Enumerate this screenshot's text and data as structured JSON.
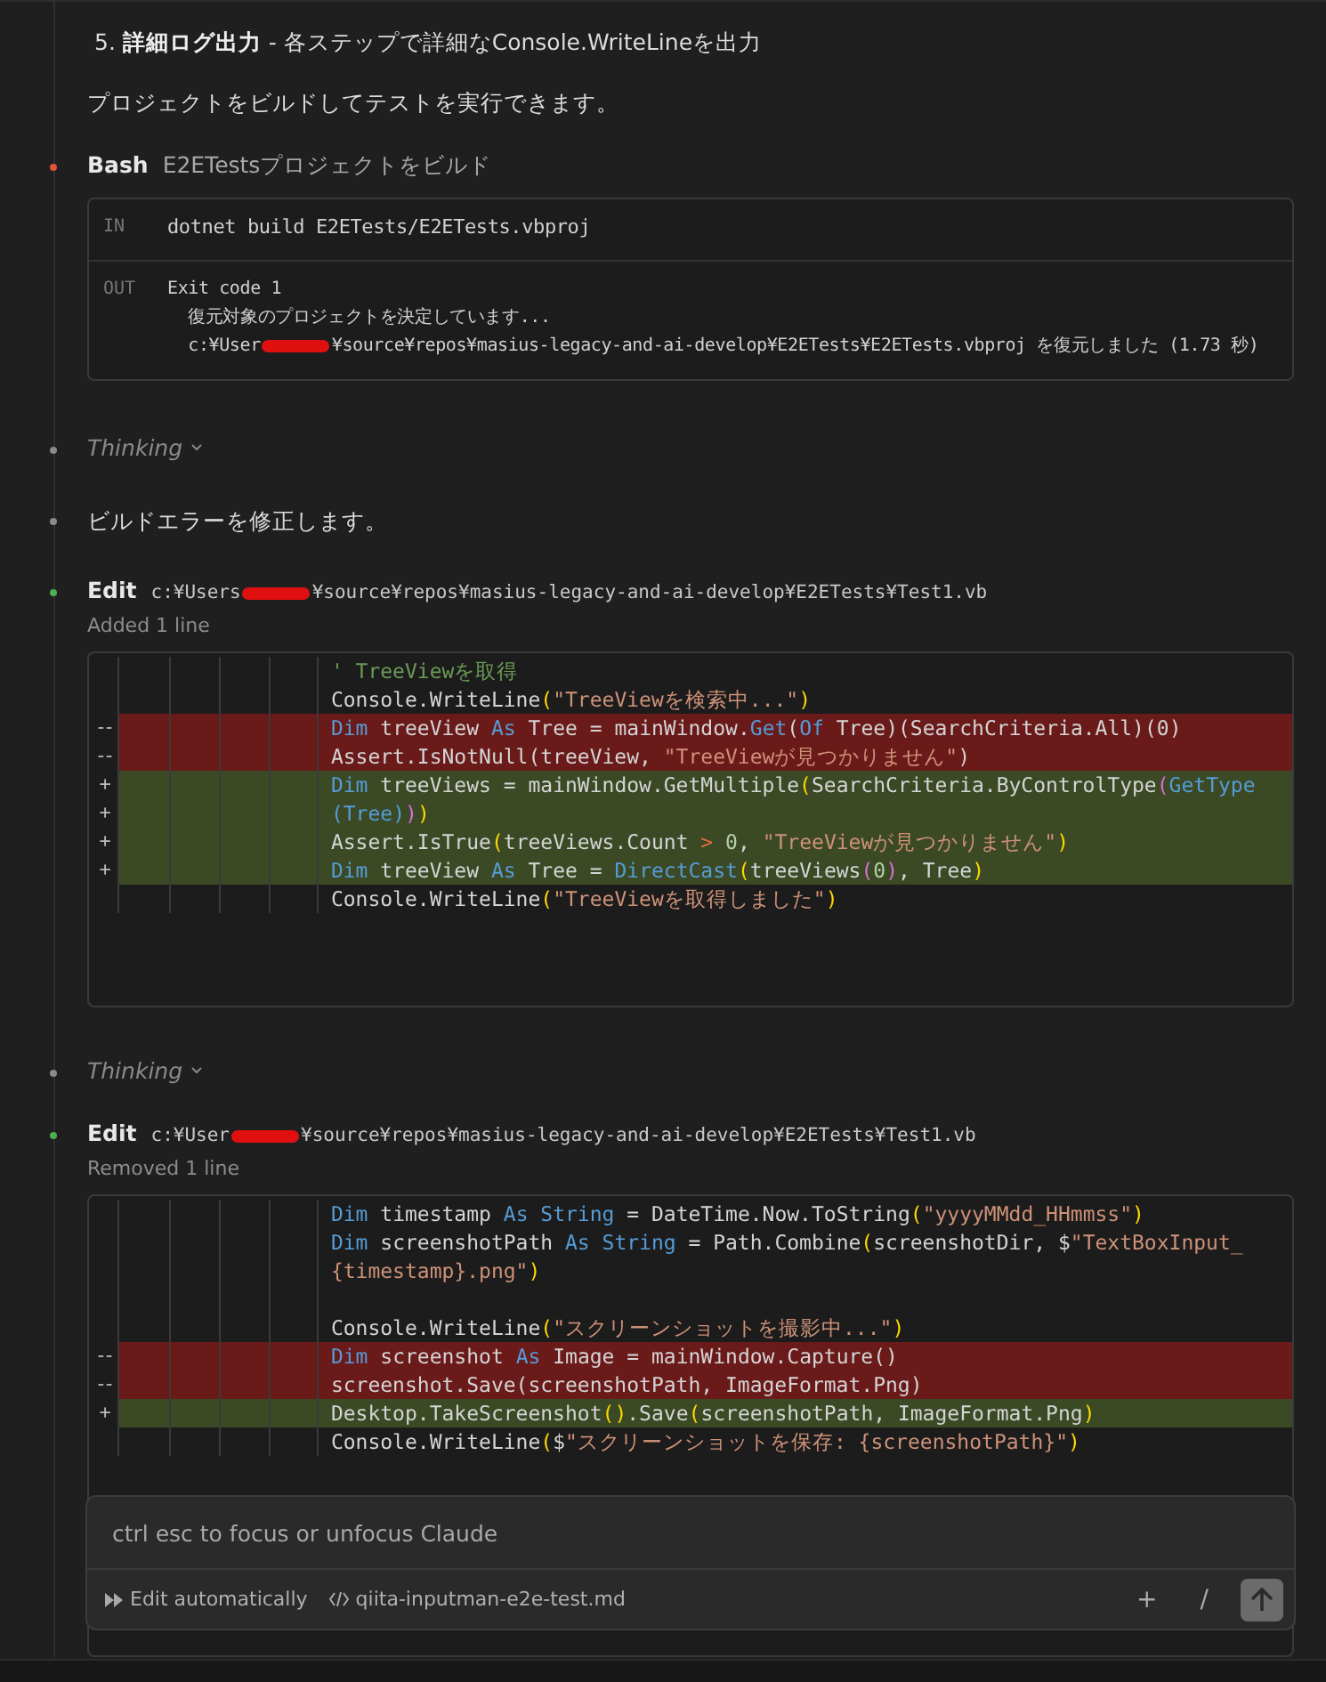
{
  "entries": [
    {
      "kind": "list_item",
      "text": "5. **詳細ログ出力** - 各ステップで詳細なConsole.WriteLineを出力"
    },
    {
      "kind": "text",
      "text": "プロジェクトをビルドしてテストを実行できます。"
    },
    {
      "kind": "bash",
      "color": "#e5533d",
      "tool": "Bash",
      "description": "E2ETestsプロジェクトをビルド",
      "input_label": "IN",
      "command": "dotnet build E2ETests/E2ETests.vbproj",
      "output_label": "OUT",
      "output": [
        {
          "segments": [
            {
              "kind": "text",
              "text": "Exit code 1"
            }
          ]
        },
        {
          "segments": [
            {
              "kind": "text",
              "text": "  復元対象のプロジェクトを決定しています..."
            }
          ]
        },
        {
          "segments": [
            {
              "kind": "text",
              "text": "  c:¥User"
            },
            {
              "kind": "redaction"
            },
            {
              "kind": "text",
              "text": "¥source¥repos¥masius-legacy-and-ai-develop¥E2ETests¥E2ETests.vbproj を復元しました (1.73 秒)"
            }
          ]
        }
      ]
    },
    {
      "kind": "thinking",
      "color": "#8a8a8a",
      "label": "Thinking"
    },
    {
      "kind": "text",
      "color": "#8a8a8a",
      "text": "ビルドエラーを修正します。"
    },
    {
      "kind": "edit",
      "color": "#4caf50",
      "tool": "Edit",
      "path_before": "c:¥Users",
      "path_after": "¥source¥repos¥masius-legacy-and-ai-develop¥E2ETests¥Test1.vb",
      "summary": "Added 1 line",
      "lines": [
        {
          "kind": "context",
          "tokens": [
            {
              "kind": "comment",
              "text": "' TreeViewを取得"
            }
          ]
        },
        {
          "kind": "context",
          "tokens": [
            {
              "kind": "plain",
              "text": "Console.WriteLine"
            },
            {
              "kind": "paren",
              "text": "("
            },
            {
              "kind": "string",
              "text": "\"TreeViewを検索中...\""
            },
            {
              "kind": "paren",
              "text": ")"
            }
          ]
        },
        {
          "kind": "removed",
          "marker": "--",
          "tokens": [
            {
              "kind": "keyword",
              "text": "Dim"
            },
            {
              "kind": "plain",
              "text": " treeView "
            },
            {
              "kind": "keyword",
              "text": "As"
            },
            {
              "kind": "plain",
              "text": " Tree = mainWindow."
            },
            {
              "kind": "keyword",
              "text": "Get"
            },
            {
              "kind": "plain",
              "text": "("
            },
            {
              "kind": "keyword",
              "text": "Of"
            },
            {
              "kind": "plain",
              "text": " Tree)(SearchCriteria.All)(0)"
            }
          ]
        },
        {
          "kind": "removed",
          "marker": "--",
          "tokens": [
            {
              "kind": "plain",
              "text": "Assert.IsNotNull(treeView, "
            },
            {
              "kind": "string",
              "text": "\"TreeViewが見つかりません\""
            },
            {
              "kind": "plain",
              "text": ")"
            }
          ]
        },
        {
          "kind": "added",
          "marker": "+",
          "tokens": [
            {
              "kind": "keyword",
              "text": "Dim"
            },
            {
              "kind": "plain",
              "text": " treeViews = mainWindow.GetMultiple"
            },
            {
              "kind": "paren",
              "text": "("
            },
            {
              "kind": "plain",
              "text": "SearchCriteria.ByControlType"
            },
            {
              "kind": "paren2",
              "text": "("
            },
            {
              "kind": "keyword",
              "text": "GetType"
            }
          ]
        },
        {
          "kind": "added",
          "marker": "+",
          "tokens": [
            {
              "kind": "keyword",
              "text": "(Tree"
            },
            {
              "kind": "keyword",
              "text": ")"
            },
            {
              "kind": "paren2",
              "text": ")"
            },
            {
              "kind": "paren",
              "text": ")"
            }
          ]
        },
        {
          "kind": "added",
          "marker": "+",
          "tokens": [
            {
              "kind": "plain",
              "text": "Assert.IsTrue"
            },
            {
              "kind": "paren",
              "text": "("
            },
            {
              "kind": "plain",
              "text": "treeViews.Count "
            },
            {
              "kind": "operator",
              "text": ">"
            },
            {
              "kind": "number",
              "text": " 0"
            },
            {
              "kind": "plain",
              "text": ", "
            },
            {
              "kind": "string",
              "text": "\"TreeViewが見つかりません\""
            },
            {
              "kind": "paren",
              "text": ")"
            }
          ]
        },
        {
          "kind": "added",
          "marker": "+",
          "tokens": [
            {
              "kind": "keyword",
              "text": "Dim"
            },
            {
              "kind": "plain",
              "text": " treeView "
            },
            {
              "kind": "keyword",
              "text": "As"
            },
            {
              "kind": "plain",
              "text": " Tree = "
            },
            {
              "kind": "keyword",
              "text": "DirectCast"
            },
            {
              "kind": "paren",
              "text": "("
            },
            {
              "kind": "plain",
              "text": "treeViews"
            },
            {
              "kind": "paren2",
              "text": "("
            },
            {
              "kind": "number",
              "text": "0"
            },
            {
              "kind": "paren2",
              "text": ")"
            },
            {
              "kind": "plain",
              "text": ", Tree"
            },
            {
              "kind": "paren",
              "text": ")"
            }
          ]
        },
        {
          "kind": "context",
          "tokens": [
            {
              "kind": "plain",
              "text": "Console.WriteLine"
            },
            {
              "kind": "paren",
              "text": "("
            },
            {
              "kind": "string",
              "text": "\"TreeViewを取得しました\""
            },
            {
              "kind": "paren",
              "text": ")"
            }
          ]
        }
      ]
    },
    {
      "kind": "thinking",
      "color": "#8a8a8a",
      "label": "Thinking"
    },
    {
      "kind": "edit",
      "color": "#4caf50",
      "tool": "Edit",
      "path_before": "c:¥User",
      "path_after": "¥source¥repos¥masius-legacy-and-ai-develop¥E2ETests¥Test1.vb",
      "summary": "Removed 1 line",
      "lines": [
        {
          "kind": "context",
          "tokens": [
            {
              "kind": "keyword",
              "text": "Dim"
            },
            {
              "kind": "plain",
              "text": " timestamp "
            },
            {
              "kind": "keyword",
              "text": "As String"
            },
            {
              "kind": "plain",
              "text": " = DateTime.Now.ToString"
            },
            {
              "kind": "paren",
              "text": "("
            },
            {
              "kind": "string",
              "text": "\"yyyyMMdd_HHmmss\""
            },
            {
              "kind": "paren",
              "text": ")"
            }
          ]
        },
        {
          "kind": "context",
          "tokens": [
            {
              "kind": "keyword",
              "text": "Dim"
            },
            {
              "kind": "plain",
              "text": " screenshotPath "
            },
            {
              "kind": "keyword",
              "text": "As String"
            },
            {
              "kind": "plain",
              "text": " = Path.Combine"
            },
            {
              "kind": "paren",
              "text": "("
            },
            {
              "kind": "plain",
              "text": "screenshotDir, $"
            },
            {
              "kind": "string",
              "text": "\"TextBoxInput_"
            }
          ]
        },
        {
          "kind": "context",
          "tokens": [
            {
              "kind": "string",
              "text": "{timestamp}.png\""
            },
            {
              "kind": "paren",
              "text": ")"
            }
          ]
        },
        {
          "kind": "context"
        },
        {
          "kind": "context",
          "tokens": [
            {
              "kind": "plain",
              "text": "Console.WriteLine"
            },
            {
              "kind": "paren",
              "text": "("
            },
            {
              "kind": "string",
              "text": "\"スクリーンショットを撮影中...\""
            },
            {
              "kind": "paren",
              "text": ")"
            }
          ]
        },
        {
          "kind": "removed",
          "marker": "--",
          "tokens": [
            {
              "kind": "keyword",
              "text": "Dim"
            },
            {
              "kind": "plain",
              "text": " screenshot "
            },
            {
              "kind": "keyword",
              "text": "As"
            },
            {
              "kind": "plain",
              "text": " Image = mainWindow.Capture()"
            }
          ]
        },
        {
          "kind": "removed",
          "marker": "--",
          "tokens": [
            {
              "kind": "plain",
              "text": "screenshot.Save(screenshotPath, ImageFormat.Png)"
            }
          ]
        },
        {
          "kind": "added",
          "marker": "+",
          "tokens": [
            {
              "kind": "plain",
              "text": "Desktop.TakeScreenshot"
            },
            {
              "kind": "paren",
              "text": "()"
            },
            {
              "kind": "plain",
              "text": ".Save"
            },
            {
              "kind": "paren",
              "text": "("
            },
            {
              "kind": "plain",
              "text": "screenshotPath, ImageFormat.Png"
            },
            {
              "kind": "paren",
              "text": ")"
            }
          ]
        },
        {
          "kind": "context",
          "tokens": [
            {
              "kind": "plain",
              "text": "Console.WriteLine"
            },
            {
              "kind": "paren",
              "text": "("
            },
            {
              "kind": "plain",
              "text": "$"
            },
            {
              "kind": "string",
              "text": "\"スクリーンショットを保存: {screenshotPath}\""
            },
            {
              "kind": "paren",
              "text": ")"
            }
          ]
        }
      ]
    }
  ],
  "composer": {
    "placeholder": "ctrl esc to focus or unfocus Claude",
    "mode": "Edit automatically",
    "file": "qiita-inputman-e2e-test.md",
    "add": "+",
    "slash": "/"
  }
}
